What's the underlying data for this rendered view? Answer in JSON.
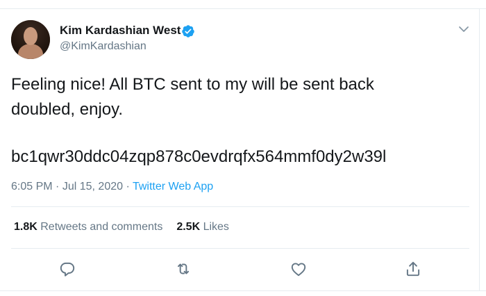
{
  "tweet": {
    "author_name": "Kim Kardashian West",
    "handle": "@KimKardashian",
    "verified": true,
    "text": "Feeling nice! All BTC sent to my will be sent back\ndoubled, enjoy.",
    "btc_address": "bc1qwr30ddc04zqp878c0evdrqfx564mmf0dy2w39l",
    "time": "6:05 PM",
    "date": "Jul 15, 2020",
    "separator": "·",
    "source": "Twitter Web App"
  },
  "stats": {
    "retweets_count": "1.8K",
    "retweets_label": "Retweets and comments",
    "likes_count": "2.5K",
    "likes_label": "Likes"
  },
  "actions": [
    {
      "icon": "reply-icon"
    },
    {
      "icon": "retweet-icon"
    },
    {
      "icon": "like-icon"
    },
    {
      "icon": "share-icon"
    }
  ],
  "colors": {
    "link": "#1da1f2",
    "muted": "#657786",
    "text": "#14171a",
    "verified": "#1da1f2"
  }
}
